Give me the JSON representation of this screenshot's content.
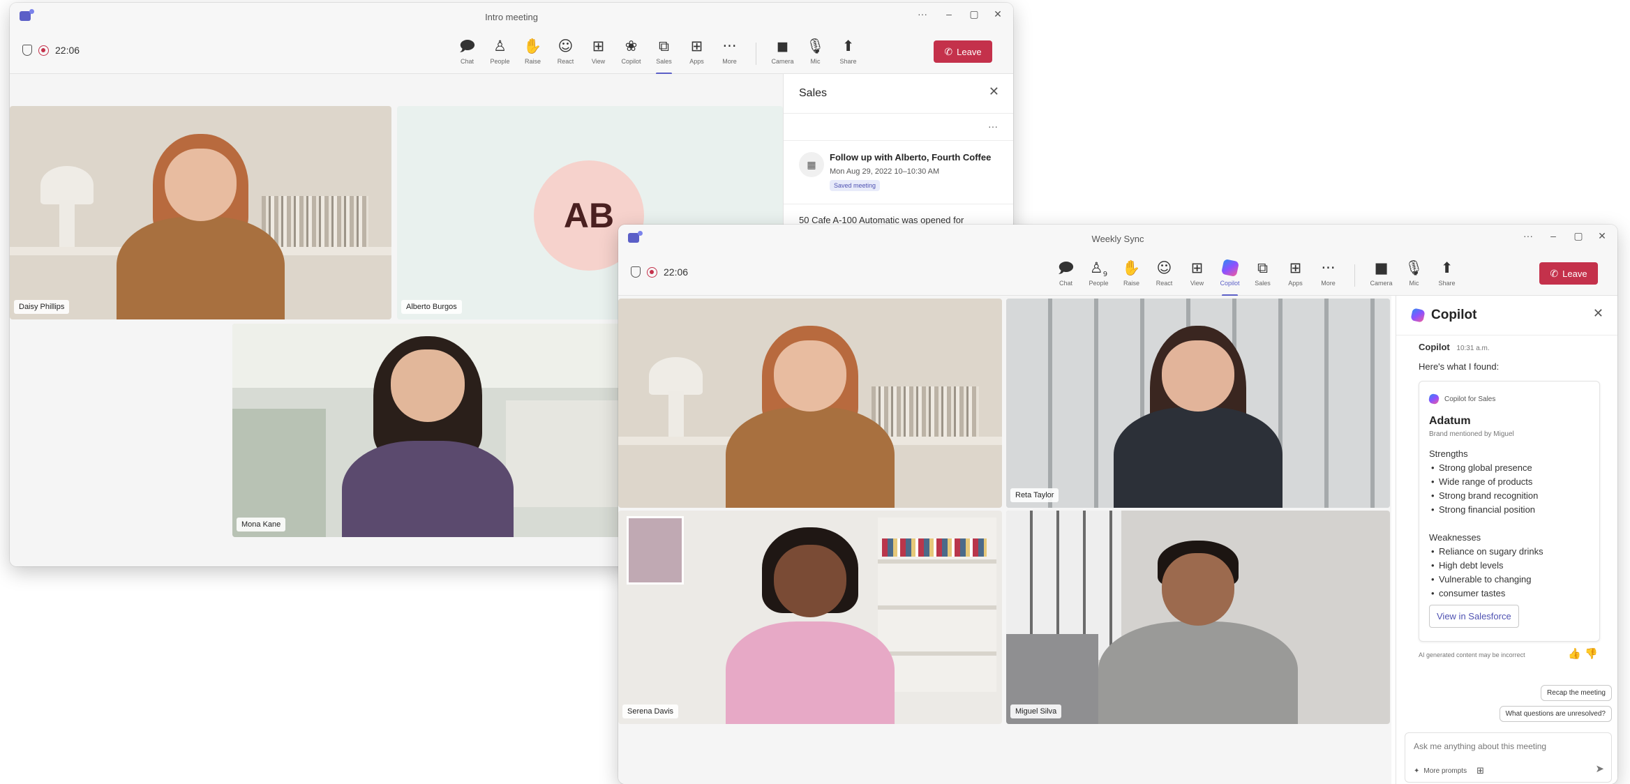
{
  "win1": {
    "title": "Intro meeting",
    "timer": "22:06",
    "toolbar": {
      "items": [
        {
          "label": "Chat",
          "icon": "chat-icon"
        },
        {
          "label": "People",
          "icon": "people-icon"
        },
        {
          "label": "Raise",
          "icon": "hand-icon"
        },
        {
          "label": "React",
          "icon": "smile-icon"
        },
        {
          "label": "View",
          "icon": "grid-icon"
        },
        {
          "label": "Copilot",
          "icon": "copilot-icon"
        },
        {
          "label": "Sales",
          "icon": "sales-icon"
        },
        {
          "label": "Apps",
          "icon": "plus-box-icon"
        },
        {
          "label": "More",
          "icon": "more-icon"
        }
      ],
      "camera": "Camera",
      "mic": "Mic",
      "share": "Share",
      "leave": "Leave"
    },
    "tiles": {
      "tile1_name": "Daisy Phillips",
      "tile2_initials": "AB",
      "tile2_name": "Alberto Burgos",
      "tile3_name": "Mona Kane"
    },
    "sales_panel": {
      "title": "Sales",
      "more": "···",
      "item_title": "Follow up with Alberto, Fourth Coffee",
      "item_date": "Mon Aug 29, 2022 10–10:30 AM",
      "item_badge": "Saved meeting",
      "snippet": "50 Cafe A-100 Automatic was opened for"
    }
  },
  "win2": {
    "title": "Weekly Sync",
    "timer": "22:06",
    "toolbar": {
      "items": [
        {
          "label": "Chat",
          "icon": "chat-icon"
        },
        {
          "label": "People",
          "icon": "people-icon",
          "badge": "9"
        },
        {
          "label": "Raise",
          "icon": "hand-icon"
        },
        {
          "label": "React",
          "icon": "smile-icon"
        },
        {
          "label": "View",
          "icon": "grid-icon"
        },
        {
          "label": "Copilot",
          "icon": "copilot-icon"
        },
        {
          "label": "Sales",
          "icon": "sales-icon"
        },
        {
          "label": "Apps",
          "icon": "plus-box-icon"
        },
        {
          "label": "More",
          "icon": "more-icon"
        }
      ],
      "camera": "Camera",
      "mic": "Mic",
      "share": "Share",
      "leave": "Leave"
    },
    "tiles": {
      "tile1_name": "",
      "tile2_name": "Reta Taylor",
      "tile3_name": "Serena Davis",
      "tile4_name": "Miguel Silva"
    },
    "copilot_panel": {
      "title": "Copilot",
      "sender": "Copilot",
      "time": "10:31 a.m.",
      "intro": "Here's what I found:",
      "card": {
        "source": "Copilot for Sales",
        "company": "Adatum",
        "mention": "Brand mentioned by Miguel",
        "strengths_label": "Strengths",
        "strengths": [
          "Strong global presence",
          "Wide range of products",
          "Strong brand recognition",
          "Strong financial position"
        ],
        "weaknesses_label": "Weaknesses",
        "weaknesses": [
          "Reliance on sugary drinks",
          "High debt levels",
          "Vulnerable to changing",
          "consumer tastes"
        ],
        "button": "View in Salesforce"
      },
      "disclaimer": "AI generated content may be incorrect",
      "suggestions": [
        "Recap the meeting",
        "What questions are unresolved?"
      ],
      "input_placeholder": "Ask me anything about this meeting",
      "more_prompts": "More prompts"
    }
  },
  "colors": {
    "accent": "#5b5fc7",
    "leave": "#c4314b",
    "avatar_ring": "#f6d2cc"
  }
}
